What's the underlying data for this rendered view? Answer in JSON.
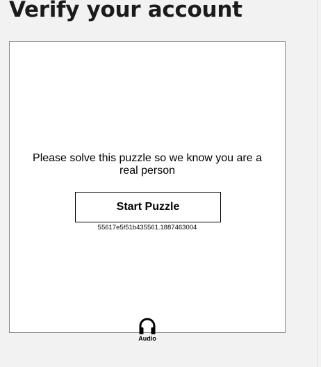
{
  "page": {
    "title": "Verify your account"
  },
  "puzzle": {
    "prompt": "Please solve this puzzle so we know you are a real person",
    "start_label": "Start Puzzle",
    "session_id": "55617e5f51b435561.1887463004"
  },
  "audio": {
    "icon": "headphones-icon",
    "label": "Audio"
  }
}
